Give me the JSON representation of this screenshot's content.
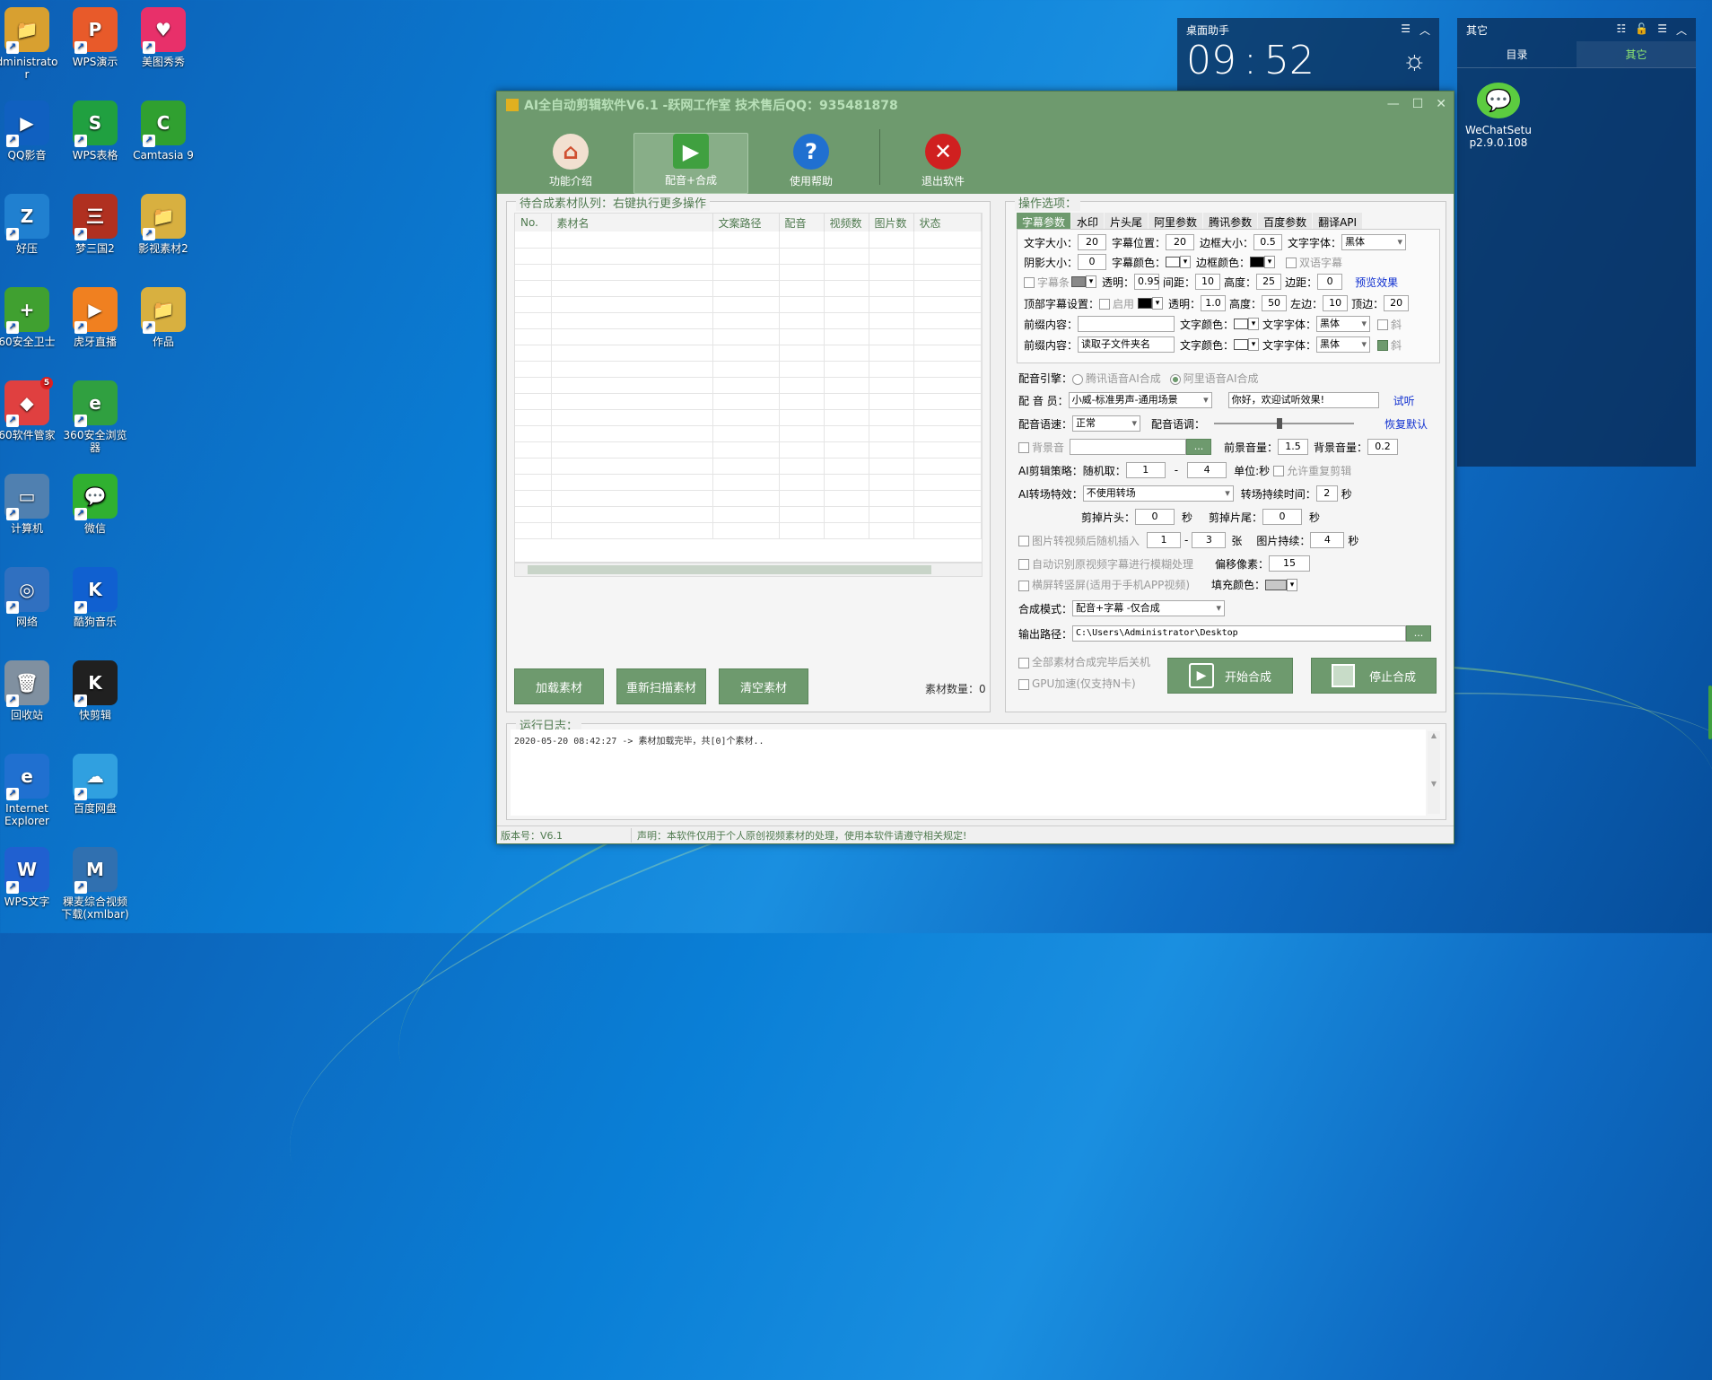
{
  "desktop": {
    "icons": [
      {
        "label": "dministrato\nr",
        "color": "#d8a030",
        "glyph": "📁"
      },
      {
        "label": "WPS演示",
        "color": "#e85a2a",
        "glyph": "P"
      },
      {
        "label": "美图秀秀",
        "color": "#e8306a",
        "glyph": "♥"
      },
      {
        "label": "QQ影音",
        "color": "#1060c0",
        "glyph": "▶"
      },
      {
        "label": "WPS表格",
        "color": "#20a040",
        "glyph": "S"
      },
      {
        "label": "Camtasia 9",
        "color": "#30a030",
        "glyph": "C"
      },
      {
        "label": "好压",
        "color": "#2080d0",
        "glyph": "Z"
      },
      {
        "label": "梦三国2",
        "color": "#b03020",
        "glyph": "三"
      },
      {
        "label": "影视素材2",
        "color": "#d8b040",
        "glyph": "📁"
      },
      {
        "label": "60安全卫士",
        "color": "#40a030",
        "glyph": "+"
      },
      {
        "label": "虎牙直播",
        "color": "#f08020",
        "glyph": "▶"
      },
      {
        "label": "作品",
        "color": "#d8b040",
        "glyph": "📁"
      },
      {
        "label": "60软件管家",
        "color": "#e04040",
        "glyph": "◆"
      },
      {
        "label": "360安全浏览\n器",
        "color": "#30a040",
        "glyph": "e"
      },
      {
        "label": "计算机",
        "color": "#5080b0",
        "glyph": "▭"
      },
      {
        "label": "微信",
        "color": "#30b030",
        "glyph": "💬"
      },
      {
        "label": "网络",
        "color": "#3070c0",
        "glyph": "◎"
      },
      {
        "label": "酷狗音乐",
        "color": "#1060d0",
        "glyph": "K"
      },
      {
        "label": "回收站",
        "color": "#8090a0",
        "glyph": "🗑"
      },
      {
        "label": "快剪辑",
        "color": "#202020",
        "glyph": "K"
      },
      {
        "label": "Internet\nExplorer",
        "color": "#2070d0",
        "glyph": "e"
      },
      {
        "label": "百度网盘",
        "color": "#30a0e0",
        "glyph": "☁"
      },
      {
        "label": "WPS文字",
        "color": "#2060d0",
        "glyph": "W"
      },
      {
        "label": "稞麦综合视频\n下载(xmlbar)",
        "color": "#3070b0",
        "glyph": "M"
      }
    ],
    "badge": "5"
  },
  "widget_clock": {
    "title": "桌面助手",
    "time_h": "09",
    "time_m": "52"
  },
  "widget_other": {
    "title": "其它",
    "tab1": "目录",
    "tab2": "其它",
    "app_label": "WeChatSetu\np2.9.0.108"
  },
  "window": {
    "title": "AI全自动剪辑软件V6.1 -跃网工作室 技术售后QQ：935481878",
    "toolbar": [
      {
        "label": "功能介绍",
        "glyph": "⌂",
        "color": "#d05030"
      },
      {
        "label": "配音+合成",
        "glyph": "▶",
        "color": "#40a040"
      },
      {
        "label": "使用帮助",
        "glyph": "?",
        "color": "#2070d0"
      },
      {
        "label": "退出软件",
        "glyph": "✕",
        "color": "#d02020"
      }
    ],
    "queue": {
      "title": "待合成素材队列：右键执行更多操作",
      "columns": [
        "No.",
        "素材名",
        "文案路径",
        "配音",
        "视频数",
        "图片数",
        "状态"
      ],
      "buttons": [
        "加载素材",
        "重新扫描素材",
        "清空素材"
      ],
      "count_label": "素材数量：",
      "count": "0"
    },
    "options": {
      "title": "操作选项：",
      "tabs": [
        "字幕参数",
        "水印",
        "片头尾",
        "阿里参数",
        "腾讯参数",
        "百度参数",
        "翻译API"
      ],
      "font_size_l": "文字大小：",
      "font_size": "20",
      "sub_pos_l": "字幕位置：",
      "sub_pos": "20",
      "border_size_l": "边框大小：",
      "border_size": "0.5",
      "font_l": "文字字体：",
      "font": "黑体",
      "shadow_l": "阴影大小：",
      "shadow": "0",
      "sub_color_l": "字幕颜色：",
      "border_color_l": "边框颜色：",
      "bilingual": "双语字幕",
      "bar_l": "字幕条",
      "alpha_l": "透明：",
      "alpha": "0.95",
      "gap_l": "间距：",
      "gap": "10",
      "height_l": "高度：",
      "height": "25",
      "margin_l": "边距：",
      "margin": "0",
      "preview": "预览效果",
      "top_l": "顶部字幕设置：",
      "enable": "启用",
      "alpha2": "1.0",
      "height2": "50",
      "left_l": "左边：",
      "left": "10",
      "top2_l": "顶边：",
      "top2": "20",
      "prefix_l": "前缀内容：",
      "prefix": "",
      "text_color_l": "文字颜色：",
      "font2_l": "文字字体：",
      "font2": "黑体",
      "italic": "斜",
      "prefix2": "读取子文件夹名",
      "font3": "黑体",
      "engine_l": "配音引擎：",
      "engine1": "腾讯语音AI合成",
      "engine2": "阿里语音AI合成",
      "voice_l": "配 音 员：",
      "voice": "小威-标准男声-通用场景",
      "voice_text": "你好，欢迎试听效果!",
      "listen": "试听",
      "speed_l": "配音语速：",
      "speed": "正常",
      "pitch_l": "配音语调：",
      "reset": "恢复默认",
      "bgm_l": "背景音",
      "bgm_btn": "...",
      "fg_vol_l": "前景音量：",
      "fg_vol": "1.5",
      "bg_vol_l": "背景音量：",
      "bg_vol": "0.2",
      "strategy_l": "AI剪辑策略：",
      "random_l": "随机取：",
      "r1": "1",
      "dash": "-",
      "r2": "4",
      "unit_l": "单位:秒",
      "repeat_l": "允许重复剪辑",
      "trans_l": "AI转场特效：",
      "trans": "不使用转场",
      "trans_dur_l": "转场持续时间：",
      "trans_dur": "2",
      "sec": "秒",
      "cut_head_l": "剪掉片头：",
      "cut_head": "0",
      "cut_tail_l": "剪掉片尾：",
      "cut_tail": "0",
      "img_l": "图片转视频后随机插入",
      "i1": "1",
      "i2": "3",
      "zhang": "张",
      "img_dur_l": "图片持续：",
      "img_dur": "4",
      "blur_l": "自动识别原视频字幕进行模糊处理",
      "offset_l": "偏移像素：",
      "offset": "15",
      "vert_l": "横屏转竖屏(适用于手机APP视频)",
      "fill_l": "填充颜色：",
      "mode_l": "合成模式：",
      "mode": "配音+字幕 -仅合成",
      "out_l": "输出路径：",
      "out": "C:\\Users\\Administrator\\Desktop",
      "out_btn": "...",
      "shutdown_l": "全部素材合成完毕后关机",
      "gpu_l": "GPU加速(仅支持N卡)",
      "start": "开始合成",
      "stop": "停止合成"
    },
    "log": {
      "title": "运行日志：",
      "line": "2020-05-20 08:42:27 -> 素材加载完毕，共[0]个素材.."
    },
    "status": {
      "version": "版本号：V6.1",
      "notice": "声明：本软件仅用于个人原创视频素材的处理，使用本软件请遵守相关规定!"
    }
  }
}
